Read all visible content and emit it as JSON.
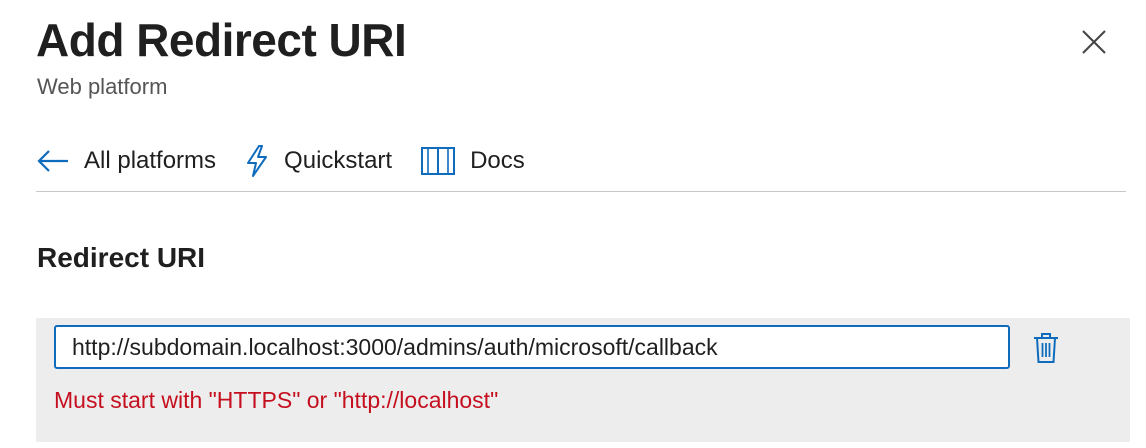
{
  "header": {
    "title": "Add Redirect URI",
    "subtitle": "Web platform"
  },
  "toolbar": {
    "items": [
      {
        "label": "All platforms",
        "icon": "arrow-left-icon"
      },
      {
        "label": "Quickstart",
        "icon": "lightning-icon"
      },
      {
        "label": "Docs",
        "icon": "book-icon"
      }
    ]
  },
  "redirect": {
    "heading": "Redirect URI",
    "uri_value": "http://subdomain.localhost:3000/admins/auth/microsoft/callback",
    "error": "Must start with \"HTTPS\" or \"http://localhost\""
  },
  "colors": {
    "accent": "#0f6cbd",
    "error": "#c50f1f",
    "row_background": "#ededed"
  }
}
